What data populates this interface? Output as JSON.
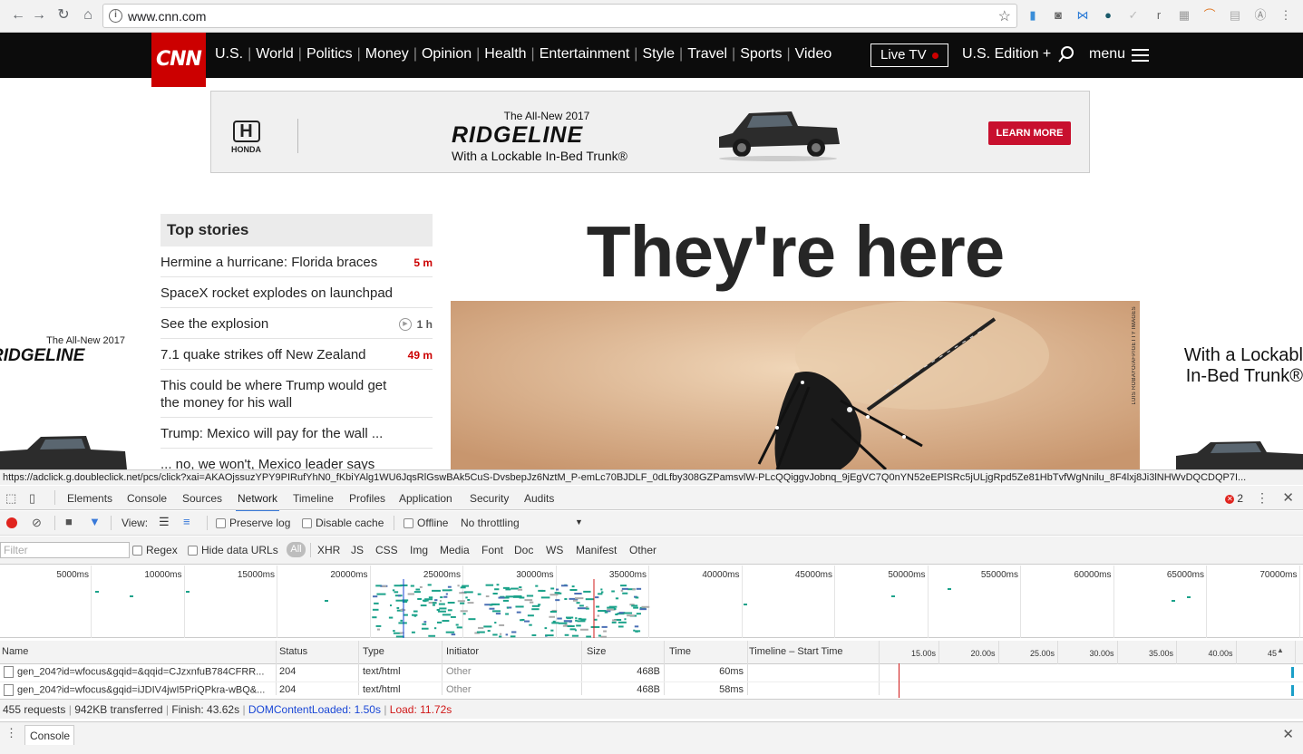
{
  "browser": {
    "url": "www.cnn.com",
    "back_icon": "back-arrow-icon",
    "forward_icon": "forward-arrow-icon",
    "reload_icon": "reload-icon",
    "home_icon": "home-icon",
    "bookmark_icon": "star-icon"
  },
  "cnn": {
    "logo": "CNN",
    "nav": [
      "U.S.",
      "World",
      "Politics",
      "Money",
      "Opinion",
      "Health",
      "Entertainment",
      "Style",
      "Travel",
      "Sports",
      "Video"
    ],
    "live_tv": "Live TV",
    "edition": "U.S. Edition +",
    "menu": "menu"
  },
  "ad": {
    "brand": "HONDA",
    "line1": "The All-New 2017",
    "line2": "RIDGELINE",
    "line3": "With a Lockable In-Bed Trunk®",
    "cta": "LEARN MORE",
    "left_line1": "The All-New 2017",
    "left_line2": "RIDGELINE",
    "right_line1": "With a Lockabl",
    "right_line2": "In-Bed Trunk®"
  },
  "top_stories": {
    "heading": "Top stories",
    "items": [
      {
        "title": "Hermine a hurricane: Florida braces",
        "time": "5 m",
        "time_color": "red"
      },
      {
        "title": "SpaceX rocket explodes on launchpad",
        "time": "",
        "time_color": "red"
      },
      {
        "title": "See the explosion",
        "time": "1 h",
        "time_color": "gray"
      },
      {
        "title": "7.1 quake strikes off New Zealand",
        "time": "49 m",
        "time_color": "red"
      },
      {
        "title": "This could be where Trump would get the money for his wall",
        "time": "",
        "time_color": "gray"
      },
      {
        "title": "Trump: Mexico will pay for the wall ...",
        "time": "",
        "time_color": "gray"
      },
      {
        "title": "... no, we won't, Mexico leader says",
        "time": "",
        "time_color": "gray"
      }
    ]
  },
  "headline": "They're here",
  "photo_credit": "LUIS ROBAYO/AFP/GETTY IMAGES",
  "status_url": "https://adclick.g.doubleclick.net/pcs/click?xai=AKAOjssuzYPY9PIRufYhN0_fKbiYAlg1WU6JqsRlGswBAk5CuS-DvsbepJz6NztM_P-emLc70BJDLF_0dLfby308GZPamsvlW-PLcQQiggvJobnq_9jEgVC7Q0nYN52eEPlSRc5jULjgRpd5Ze81HbTvfWgNnilu_8F4lxj8Ji3lNHWvDQCDQP7I...",
  "devtools": {
    "tabs": [
      "Elements",
      "Console",
      "Sources",
      "Network",
      "Timeline",
      "Profiles",
      "Application",
      "Security",
      "Audits"
    ],
    "active_tab": "Network",
    "error_count": "2",
    "toolbar": {
      "view_label": "View:",
      "preserve_log": "Preserve log",
      "disable_cache": "Disable cache",
      "offline": "Offline",
      "throttling": "No throttling"
    },
    "filter": {
      "placeholder": "Filter",
      "regex": "Regex",
      "hide_data_urls": "Hide data URLs",
      "all": "All",
      "types": [
        "XHR",
        "JS",
        "CSS",
        "Img",
        "Media",
        "Font",
        "Doc",
        "WS",
        "Manifest",
        "Other"
      ]
    },
    "overview_ticks": [
      "5000ms",
      "10000ms",
      "15000ms",
      "20000ms",
      "25000ms",
      "30000ms",
      "35000ms",
      "40000ms",
      "45000ms",
      "50000ms",
      "55000ms",
      "60000ms",
      "65000ms",
      "70000ms"
    ],
    "columns": {
      "name": "Name",
      "status": "Status",
      "type": "Type",
      "initiator": "Initiator",
      "size": "Size",
      "time": "Time",
      "timeline": "Timeline – Start Time"
    },
    "timeline_ticks": [
      "15.00s",
      "20.00s",
      "25.00s",
      "30.00s",
      "35.00s",
      "40.00s",
      "45"
    ],
    "rows": [
      {
        "name": "gen_204?id=wfocus&gqid=&qqid=CJzxnfuB784CFRR...",
        "status": "204",
        "type": "text/html",
        "initiator": "Other",
        "size": "468B",
        "time": "60ms"
      },
      {
        "name": "gen_204?id=wfocus&gqid=iJDIV4jwI5PriQPkra-wBQ&...",
        "status": "204",
        "type": "text/html",
        "initiator": "Other",
        "size": "468B",
        "time": "58ms"
      }
    ],
    "summary": {
      "requests": "455 requests",
      "transferred": "942KB transferred",
      "finish": "Finish: 43.62s",
      "dcl": "DOMContentLoaded: 1.50s",
      "load": "Load: 11.72s"
    },
    "drawer_tab": "Console"
  }
}
